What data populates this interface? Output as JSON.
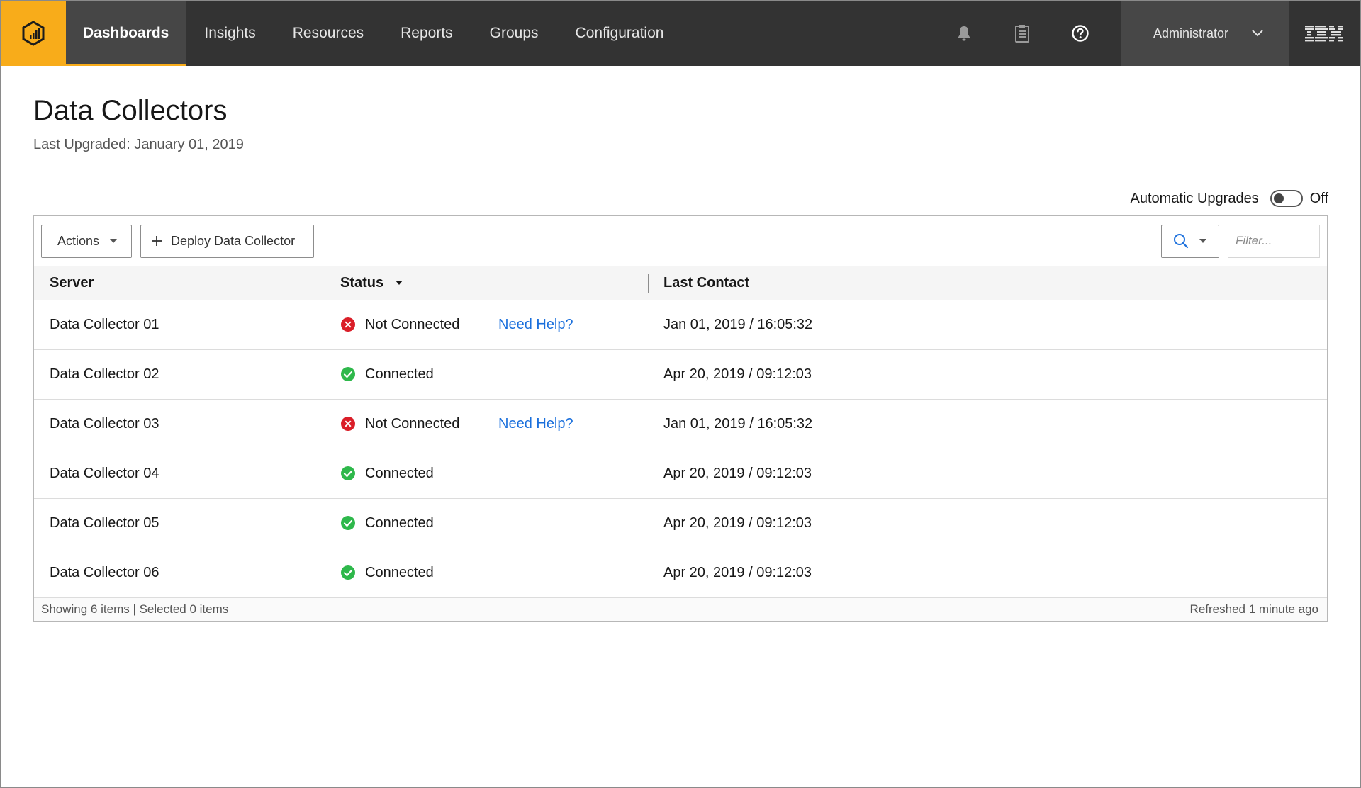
{
  "nav": {
    "items": [
      {
        "label": "Dashboards",
        "active": true
      },
      {
        "label": "Insights"
      },
      {
        "label": "Resources"
      },
      {
        "label": "Reports"
      },
      {
        "label": "Groups"
      },
      {
        "label": "Configuration"
      }
    ],
    "user": "Administrator",
    "icons": [
      "bell-icon",
      "clipboard-icon",
      "help-icon"
    ],
    "brand_logo": "IBM",
    "accent_color": "#f8ac1a"
  },
  "page": {
    "title": "Data Collectors",
    "subtitle": "Last Upgraded: January 01, 2019"
  },
  "auto_upgrades": {
    "label": "Automatic Upgrades",
    "state": "Off"
  },
  "toolbar": {
    "actions_label": "Actions",
    "deploy_label": "Deploy Data Collector",
    "filter_placeholder": "Filter..."
  },
  "table": {
    "columns": [
      "Server",
      "Status",
      "Last Contact"
    ],
    "rows": [
      {
        "server": "Data Collector 01",
        "status": "Not Connected",
        "ok": false,
        "help": "Need Help?",
        "last_contact": "Jan 01, 2019 / 16:05:32"
      },
      {
        "server": "Data Collector 02",
        "status": "Connected",
        "ok": true,
        "help": "",
        "last_contact": "Apr 20, 2019 / 09:12:03"
      },
      {
        "server": "Data Collector 03",
        "status": "Not Connected",
        "ok": false,
        "help": "Need Help?",
        "last_contact": "Jan 01, 2019 / 16:05:32"
      },
      {
        "server": "Data Collector 04",
        "status": "Connected",
        "ok": true,
        "help": "",
        "last_contact": "Apr 20, 2019 / 09:12:03"
      },
      {
        "server": "Data Collector 05",
        "status": "Connected",
        "ok": true,
        "help": "",
        "last_contact": "Apr 20, 2019 / 09:12:03"
      },
      {
        "server": "Data Collector 06",
        "status": "Connected",
        "ok": true,
        "help": "",
        "last_contact": "Apr 20, 2019 / 09:12:03"
      }
    ],
    "status_colors": {
      "connected": "#2eb84b",
      "not_connected": "#da1e28"
    }
  },
  "footer": {
    "summary": "Showing 6 items | Selected 0 items",
    "refreshed": "Refreshed 1 minute ago"
  }
}
